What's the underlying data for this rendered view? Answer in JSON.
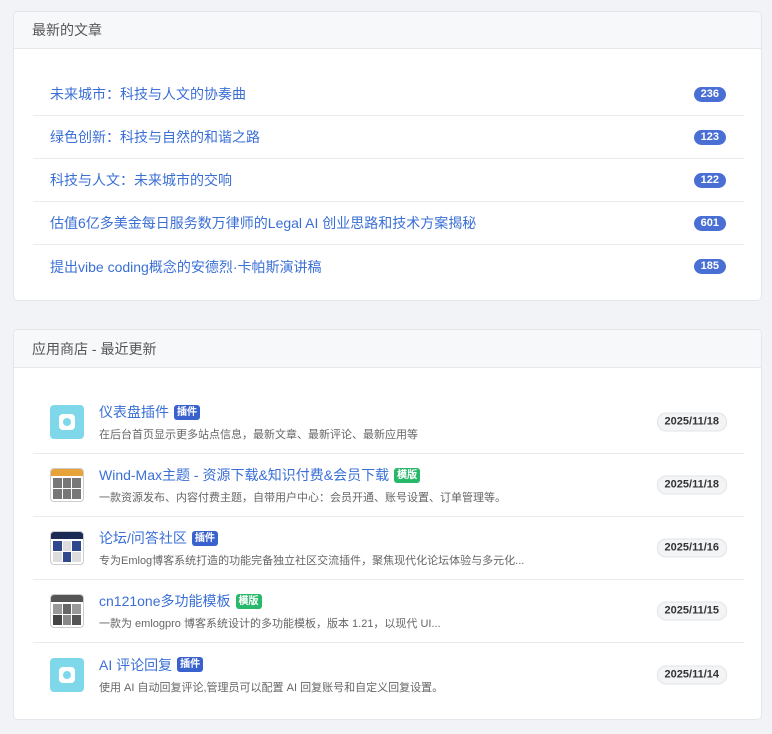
{
  "latest_articles": {
    "header": "最新的文章",
    "items": [
      {
        "title": "未来城市：科技与人文的协奏曲",
        "count": "236"
      },
      {
        "title": "绿色创新：科技与自然的和谐之路",
        "count": "123"
      },
      {
        "title": "科技与人文：未来城市的交响",
        "count": "122"
      },
      {
        "title": "估值6亿多美金每日服务数万律师的Legal AI 创业思路和技术方案揭秘",
        "count": "601"
      },
      {
        "title": "提出vibe coding概念的安德烈·卡帕斯演讲稿",
        "count": "185"
      }
    ]
  },
  "app_store": {
    "header": "应用商店 - 最近更新",
    "items": [
      {
        "title": "仪表盘插件",
        "badge": "插件",
        "badge_type": "plugin",
        "icon": "plugin-icon",
        "desc": "在后台首页显示更多站点信息，最新文章、最新评论、最新应用等",
        "date": "2025/11/18"
      },
      {
        "title": "Wind-Max主题 - 资源下载&知识付费&会员下载",
        "badge": "模版",
        "badge_type": "template",
        "icon": "theme-thumbnail",
        "desc": "一款资源发布、内容付费主题，自带用户中心：会员开通、账号设置、订单管理等。",
        "date": "2025/11/18"
      },
      {
        "title": "论坛/问答社区",
        "badge": "插件",
        "badge_type": "plugin",
        "icon": "forum-thumbnail",
        "desc": "专为Emlog博客系统打造的功能完备独立社区交流插件，聚焦现代化论坛体验与多元化...",
        "date": "2025/11/16"
      },
      {
        "title": "cn121one多功能模板",
        "badge": "模版",
        "badge_type": "template",
        "icon": "template-thumbnail",
        "desc": "一款为 emlogpro 博客系统设计的多功能模板，版本 1.21，以现代 UI...",
        "date": "2025/11/15"
      },
      {
        "title": "AI 评论回复",
        "badge": "插件",
        "badge_type": "plugin",
        "icon": "plugin-icon",
        "desc": "使用 AI 自动回复评论,管理员可以配置 AI 回复账号和自定义回复设置。",
        "date": "2025/11/14"
      }
    ]
  },
  "colors": {
    "link": "#3a6fd6",
    "count_badge": "#4a6fd4",
    "plugin_badge": "#3a62cf",
    "template_badge": "#27b86a",
    "plugin_icon_bg": "#7fd8ea"
  }
}
